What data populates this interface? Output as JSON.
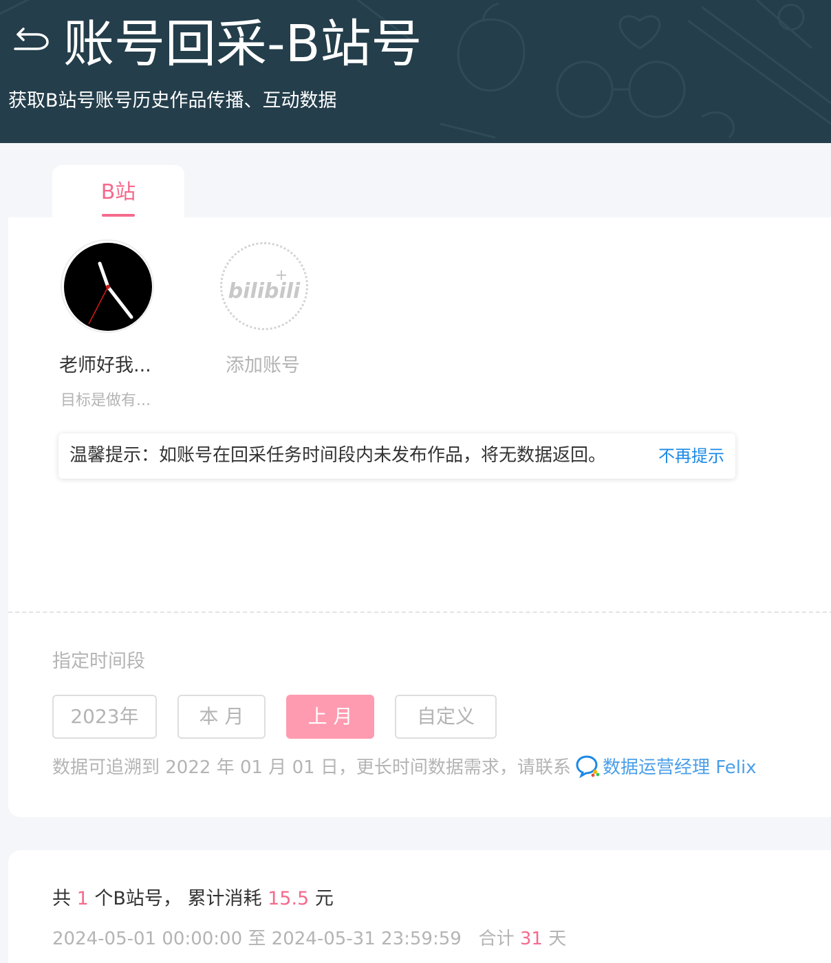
{
  "header": {
    "title": "账号回采-B站号",
    "subtitle": "获取B站号账号历史作品传播、互动数据"
  },
  "tabs": [
    {
      "label": "B站",
      "active": true
    }
  ],
  "accounts": [
    {
      "name": "老师好我...",
      "desc": "目标是做有..."
    }
  ],
  "add_account": {
    "label": "添加账号",
    "placeholder_logo": "bilibili"
  },
  "tip": {
    "text": "温馨提示：如账号在回采任务时间段内未发布作品，将无数据返回。",
    "dismiss": "不再提示"
  },
  "period": {
    "label": "指定时间段",
    "options": [
      {
        "label": "2023年",
        "active": false
      },
      {
        "label": "本 月",
        "active": false
      },
      {
        "label": "上 月",
        "active": true
      },
      {
        "label": "自定义",
        "active": false
      }
    ],
    "trace_note": "数据可追溯到 2022 年 01 月 01 日，更长时间数据需求，请联系",
    "contact_label": "数据运营经理 Felix"
  },
  "summary": {
    "prefix": "共",
    "account_count": "1",
    "count_suffix": "个B站号，",
    "cost_label": "累计消耗",
    "cost_value": "15.5",
    "cost_unit": "元",
    "range_text": "2024-05-01 00:00:00 至 2024-05-31 23:59:59",
    "days_label": "合计",
    "days_value": "31",
    "days_unit": "天"
  },
  "colors": {
    "header_bg": "#243e4b",
    "accent_pink": "#f56a8c",
    "active_button": "#fe9bb0",
    "link_blue": "#1a88e6"
  },
  "icons": {
    "back": "back-arrow-icon",
    "avatar": "clock-avatar-icon",
    "chat": "chat-bubble-icon"
  }
}
